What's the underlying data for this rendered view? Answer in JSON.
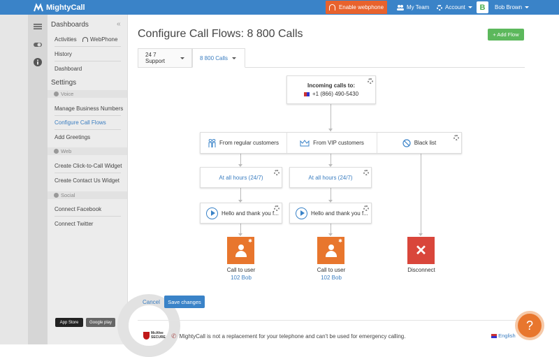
{
  "header": {
    "brand": "MightyCall",
    "webphone_button": "Enable webphone",
    "my_team": "My Team",
    "account": "Account",
    "badge": "B",
    "user_name": "Bob Brown"
  },
  "sidebar": {
    "dashboards_title": "Dashboards",
    "activities": "Activities",
    "webphone": "WebPhone",
    "history": "History",
    "dashboard": "Dashboard",
    "settings_title": "Settings",
    "voice_section": "Voice",
    "manage_numbers": "Manage Business Numbers",
    "configure_flows": "Configure Call Flows",
    "add_greetings": "Add Greetings",
    "web_section": "Web",
    "click_to_call": "Create Click-to-Call Widget",
    "contact_widget": "Create Contact Us Widget",
    "social_section": "Social",
    "connect_facebook": "Connect Facebook",
    "connect_twitter": "Connect Twitter",
    "app_store": "App Store",
    "google_play": "Google play"
  },
  "main": {
    "title": "Configure Call Flows: 8 800 Calls",
    "add_flow": "+ Add Flow",
    "tabs": [
      {
        "label": "24 7 Support"
      },
      {
        "label": "8 800 Calls"
      }
    ],
    "flow": {
      "incoming_title": "Incoming calls to:",
      "incoming_number": "+1 (866) 490-5430",
      "groups": [
        "From regular customers",
        "From VIP customers",
        "Black list"
      ],
      "schedule": [
        "At all hours (24/7)",
        "At all hours (24/7)"
      ],
      "greeting": [
        "Hello and thank you f...",
        "Hello and thank you f..."
      ],
      "actions": [
        {
          "label": "Call to user",
          "sub": "102 Bob"
        },
        {
          "label": "Call to user",
          "sub": "102 Bob"
        },
        {
          "label": "Disconnect",
          "sub": ""
        }
      ]
    },
    "cancel": "Cancel",
    "save": "Save changes"
  },
  "footer": {
    "mcafee": "McAfee SECURE",
    "disclaimer": "MightyCall is not a replacement for your telephone and can't be used for emergency calling.",
    "language": "English",
    "help": "?"
  },
  "colors": {
    "topbar": "#3a83c8",
    "accent_orange": "#e8762d",
    "danger": "#d9463b",
    "success": "#5cb85c",
    "link": "#3a7dc0"
  }
}
